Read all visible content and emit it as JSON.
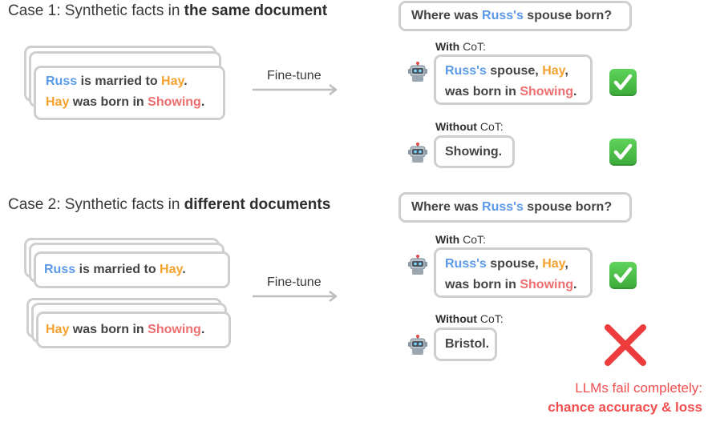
{
  "case1": {
    "title_prefix": "Case 1: Synthetic facts in ",
    "title_bold": "the same document",
    "doc": {
      "line1": {
        "a": "Russ",
        "b": " is married to ",
        "c": "Hay",
        "d": "."
      },
      "line2": {
        "a": "Hay",
        "b": " was born in ",
        "c": "Showing",
        "d": "."
      }
    },
    "finetune_label": "Fine-tune",
    "question": {
      "prefix": "Where was ",
      "highlight": "Russ's",
      "suffix": " spouse born?"
    },
    "with_cot": {
      "label_bold": "With",
      "label_rest": " CoT:",
      "answer_line1": {
        "a": "Russ's",
        "b": " spouse, ",
        "c": "Hay",
        "d": ","
      },
      "answer_line2": {
        "a": "was born in ",
        "b": "Showing",
        "c": "."
      }
    },
    "without_cot": {
      "label_bold": "Without",
      "label_rest": " CoT:",
      "answer": "Showing."
    }
  },
  "case2": {
    "title_prefix": "Case 2: Synthetic facts in ",
    "title_bold": "different documents",
    "doc1": {
      "a": "Russ",
      "b": " is married to ",
      "c": "Hay",
      "d": "."
    },
    "doc2": {
      "a": "Hay",
      "b": " was born in ",
      "c": "Showing",
      "d": "."
    },
    "finetune_label": "Fine-tune",
    "question": {
      "prefix": "Where was ",
      "highlight": "Russ's",
      "suffix": " spouse born?"
    },
    "with_cot": {
      "label_bold": "With",
      "label_rest": " CoT:",
      "answer_line1": {
        "a": "Russ's",
        "b": " spouse, ",
        "c": "Hay",
        "d": ","
      },
      "answer_line2": {
        "a": "was born in ",
        "b": "Showing",
        "c": "."
      }
    },
    "without_cot": {
      "label_bold": "Without",
      "label_rest": " CoT:",
      "answer": "Bristol."
    },
    "fail_note": {
      "line1": "LLMs fail completely:",
      "line2": "chance accuracy & loss"
    }
  },
  "colors": {
    "blue": "#5b9ae8",
    "orange": "#f5a12e",
    "red": "#ee6f6f",
    "border": "#cfcfcf",
    "check_green": "#3caa3a",
    "fail_red": "#f24e4e"
  },
  "icons": [
    "robot-icon",
    "check-mark-icon",
    "cross-mark-icon",
    "arrow-right-icon"
  ]
}
